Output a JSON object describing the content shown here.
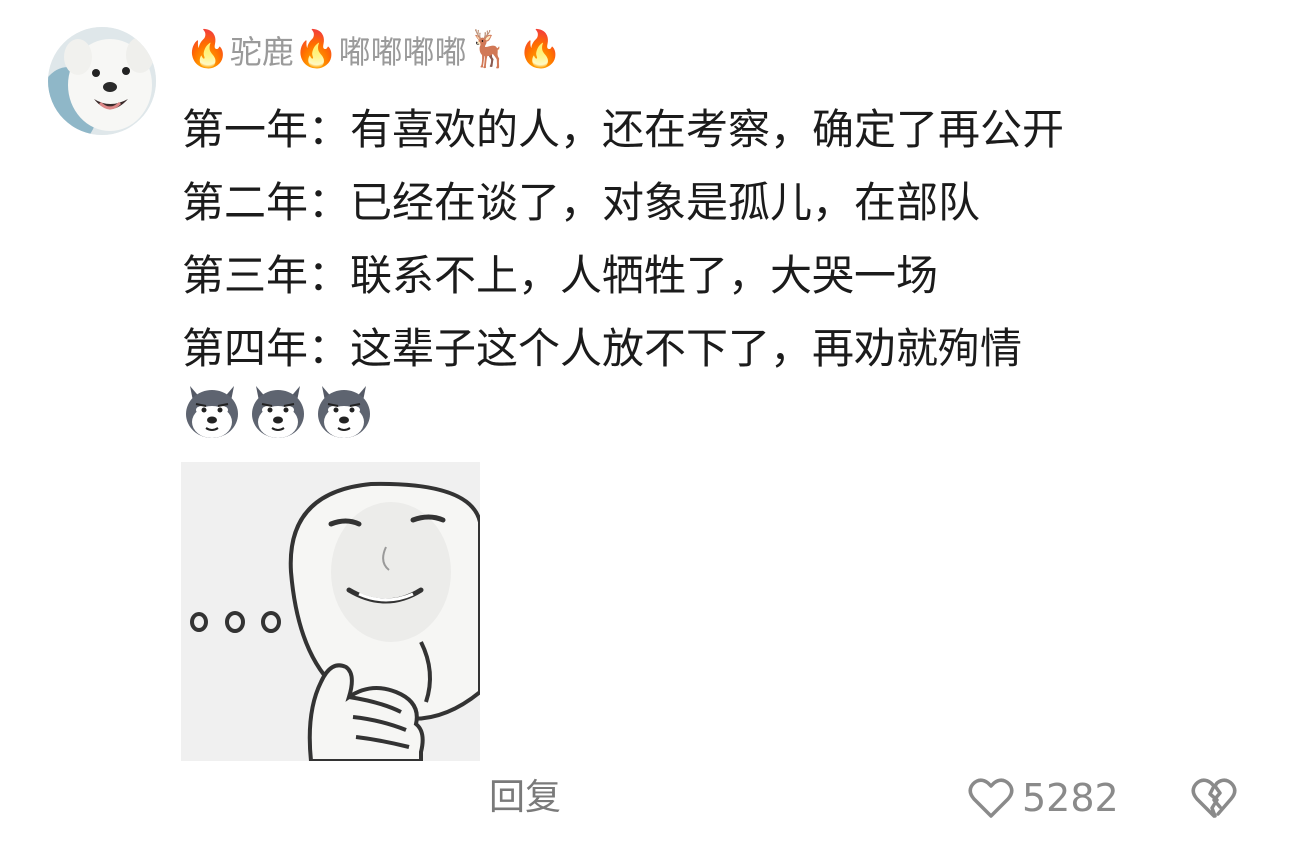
{
  "comment": {
    "avatar": "white-dog-avatar",
    "username": {
      "part1": "驼鹿",
      "part2": "嘟嘟嘟嘟",
      "fire_emoji": "🔥",
      "deer_emoji": "🦌"
    },
    "lines": [
      "第一年：有喜欢的人，还在考察，确定了再公开",
      "第二年：已经在谈了，对象是孤儿，在部队",
      "第三年：联系不上，人牺牲了，大哭一场",
      "第四年：这辈子这个人放不下了，再劝就殉情"
    ],
    "emoji_stickers": [
      "doge-sticker",
      "doge-sticker",
      "doge-sticker"
    ],
    "image": "thinking-meme-face"
  },
  "actions": {
    "reply_label": "回复",
    "like_count": "5282",
    "like_icon": "heart-outline-icon",
    "dislike_icon": "broken-heart-icon"
  }
}
